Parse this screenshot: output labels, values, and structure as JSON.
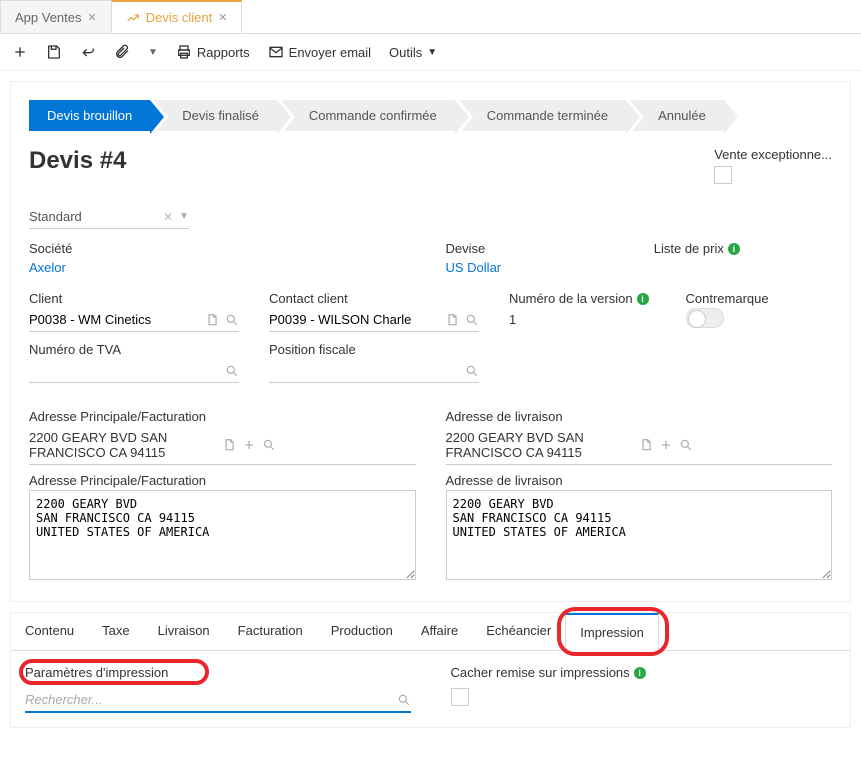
{
  "topTabs": {
    "inactive": "App Ventes",
    "active": "Devis client"
  },
  "toolbar": {
    "reports": "Rapports",
    "sendEmail": "Envoyer email",
    "tools": "Outils"
  },
  "status": {
    "s1": "Devis brouillon",
    "s2": "Devis finalisé",
    "s3": "Commande confirmée",
    "s4": "Commande terminée",
    "s5": "Annulée"
  },
  "title": "Devis #4",
  "exceptLabel": "Vente exceptionne...",
  "templateSelect": "Standard",
  "labels": {
    "company": "Société",
    "currency": "Devise",
    "priceList": "Liste de prix",
    "client": "Client",
    "contact": "Contact client",
    "version": "Numéro de la version",
    "contremarque": "Contremarque",
    "vat": "Numéro de TVA",
    "fiscal": "Position fiscale",
    "mainAddr": "Adresse Principale/Facturation",
    "deliveryAddr": "Adresse de livraison",
    "printParams": "Paramètres d'impression",
    "hideDiscount": "Cacher remise sur impressions"
  },
  "values": {
    "company": "Axelor",
    "currency": "US Dollar",
    "client": "P0038 - WM Cinetics",
    "contact": "P0039 - WILSON Charle",
    "version": "1",
    "mainAddrLine": "2200 GEARY BVD SAN FRANCISCO CA 94115",
    "deliveryAddrLine": "2200 GEARY BVD SAN FRANCISCO CA 94115",
    "mainAddrText": "2200 GEARY BVD\nSAN FRANCISCO CA 94115\nUNITED STATES OF AMERICA",
    "deliveryAddrText": "2200 GEARY BVD\nSAN FRANCISCO CA 94115\nUNITED STATES OF AMERICA"
  },
  "bottomTabs": {
    "t1": "Contenu",
    "t2": "Taxe",
    "t3": "Livraison",
    "t4": "Facturation",
    "t5": "Production",
    "t6": "Affaire",
    "t7": "Echéancier",
    "t8": "Impression"
  },
  "placeholders": {
    "search": "Rechercher..."
  }
}
